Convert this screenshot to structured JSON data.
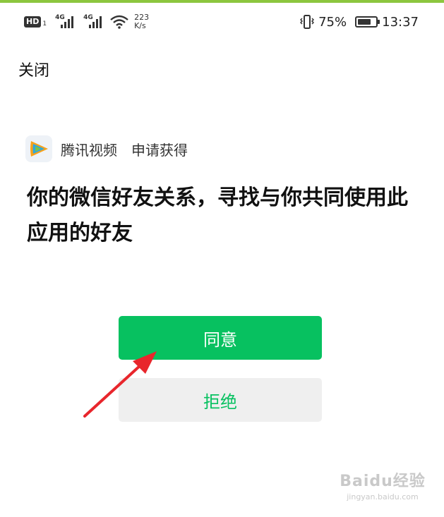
{
  "status_bar": {
    "hd": "HD",
    "hd_sub": "1",
    "signal1_tag": "4G",
    "signal2_tag": "4G",
    "speed_value": "223",
    "speed_unit": "K/s",
    "battery_percent": "75%",
    "battery_level": 0.75,
    "time": "13:37",
    "icons": [
      "vibrate-icon",
      "wifi-icon",
      "battery-icon"
    ]
  },
  "header": {
    "close_label": "关闭"
  },
  "auth": {
    "app_name": "腾讯视频",
    "request_text": "申请获得",
    "permission_title": "你的微信好友关系，寻找与你共同使用此应用的好友",
    "agree_label": "同意",
    "reject_label": "拒绝"
  },
  "watermark": {
    "main": "Baidu经验",
    "sub": "jingyan.baidu.com"
  },
  "colors": {
    "accent_green": "#07c160",
    "reject_bg": "#efefef",
    "arrow_red": "#e8262c",
    "top_bar": "#8cc63f"
  }
}
